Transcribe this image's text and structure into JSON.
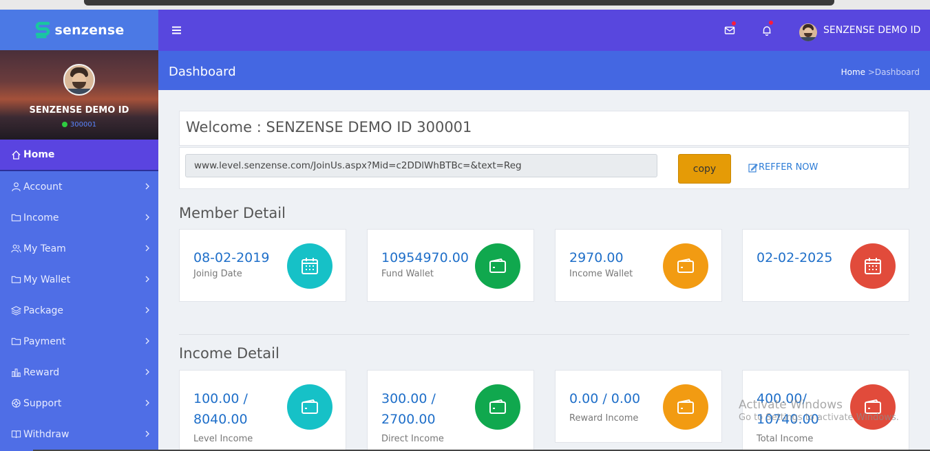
{
  "brand": {
    "name": "senzense",
    "accent": "#19c7a0"
  },
  "sidebar": {
    "profile": {
      "name": "SENZENSE DEMO ID",
      "id": "300001",
      "status_color": "#2ecc40"
    },
    "items": [
      {
        "label": "Home",
        "icon": "home-icon",
        "active": true
      },
      {
        "label": "Account",
        "icon": "user-icon"
      },
      {
        "label": "Income",
        "icon": "folder-icon"
      },
      {
        "label": "My Team",
        "icon": "team-icon"
      },
      {
        "label": "My Wallet",
        "icon": "wallet-icon"
      },
      {
        "label": "Package",
        "icon": "layers-icon"
      },
      {
        "label": "Payment",
        "icon": "folder-icon"
      },
      {
        "label": "Reward",
        "icon": "bar-chart-icon"
      },
      {
        "label": "Support",
        "icon": "gear-icon"
      },
      {
        "label": "Withdraw",
        "icon": "book-icon"
      }
    ]
  },
  "header": {
    "user_name": "SENZENSE DEMO ID"
  },
  "page": {
    "title": "Dashboard",
    "breadcrumb": {
      "home": "Home",
      "separator": " >",
      "current": "Dashboard"
    }
  },
  "welcome": {
    "text": "Welcome : SENZENSE DEMO ID 300001"
  },
  "referral": {
    "url": "www.level.senzense.com/JoinUs.aspx?Mid=c2DDlWhBTBc=&text=Reg",
    "copy_label": "copy",
    "refer_label": "REFFER NOW"
  },
  "member_detail": {
    "title": "Member Detail",
    "cards": [
      {
        "value": "08-02-2019",
        "label": "Joinig Date",
        "icon": "calendar-icon",
        "color": "#16c1c7"
      },
      {
        "value": "10954970.00",
        "label": "Fund Wallet",
        "icon": "wallet-icon",
        "color": "#10a84e"
      },
      {
        "value": "2970.00",
        "label": "Income Wallet",
        "icon": "wallet-icon",
        "color": "#f29b12"
      },
      {
        "value": "02-02-2025",
        "label": "",
        "icon": "calendar-icon",
        "color": "#e14b3b"
      }
    ]
  },
  "income_detail": {
    "title": "Income Detail",
    "cards": [
      {
        "value_line1": "100.00 /",
        "value_line2": "8040.00",
        "label": "Level Income",
        "icon": "wallet-icon",
        "color": "#16c1c7"
      },
      {
        "value_line1": "300.00 /",
        "value_line2": "2700.00",
        "label": "Direct Income",
        "icon": "wallet-icon",
        "color": "#10a84e"
      },
      {
        "value_line1": "0.00 / 0.00",
        "value_line2": "",
        "label": "Reward Income",
        "icon": "wallet-icon",
        "color": "#f29b12"
      },
      {
        "value_line1": "400.00/",
        "value_line2": "10740.00",
        "label": "Total Income",
        "icon": "wallet-icon",
        "color": "#e14b3b"
      }
    ]
  },
  "watermark": {
    "line1": "Activate Windows",
    "line2": "Go to Settings to activate Windows."
  }
}
